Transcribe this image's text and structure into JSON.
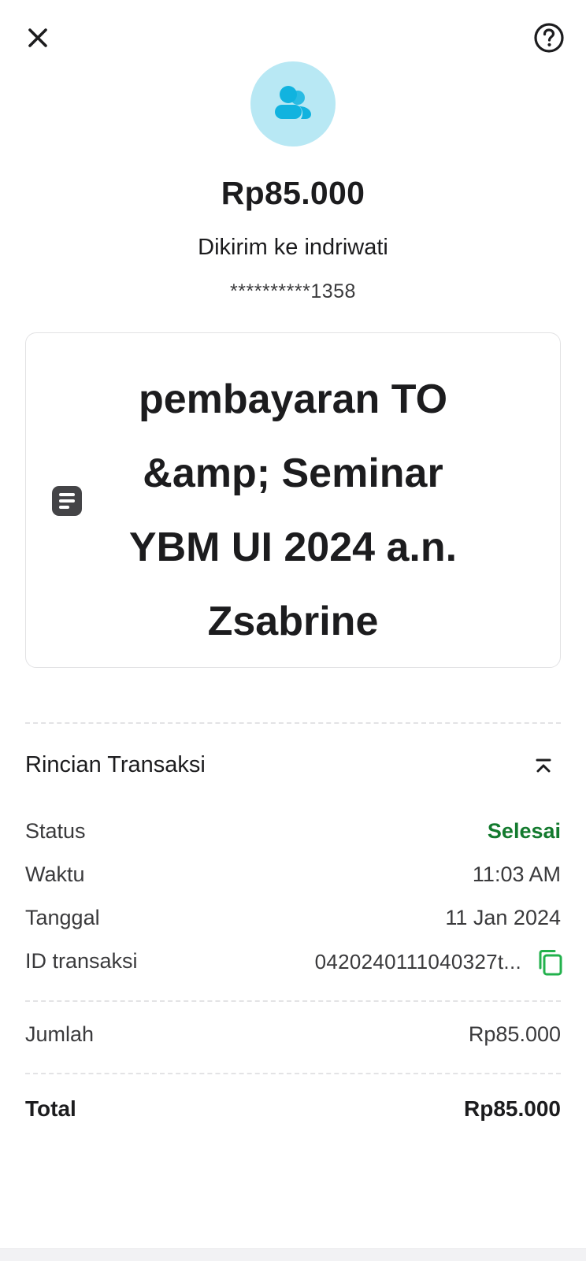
{
  "header": {
    "close_icon": "close-icon",
    "help_icon": "help-circle-icon"
  },
  "recipient_avatar_icon": "people-icon",
  "colors": {
    "avatar_bg": "#b8e8f4",
    "avatar_icon": "#11b3df",
    "status_success": "#137a2e",
    "copy_icon": "#22b14c"
  },
  "summary": {
    "amount": "Rp85.000",
    "recipient": "Dikirim ke indriwati",
    "account_masked": "**********1358"
  },
  "note": {
    "icon": "note-icon",
    "text": "pembayaran TO &amp; Seminar YBM UI 2024 a.n. Zsabrine"
  },
  "details": {
    "title": "Rincian Transaksi",
    "collapse_icon": "chevron-up-collapse-icon",
    "rows": [
      {
        "label": "Status",
        "value": "Selesai"
      },
      {
        "label": "Waktu",
        "value": "11:03 AM"
      },
      {
        "label": "Tanggal",
        "value": "11 Jan 2024"
      },
      {
        "label": "ID transaksi",
        "value": "0420240111040327t..."
      }
    ],
    "copy_icon": "copy-icon",
    "amount_row": {
      "label": "Jumlah",
      "value": "Rp85.000"
    },
    "total_row": {
      "label": "Total",
      "value": "Rp85.000"
    }
  }
}
